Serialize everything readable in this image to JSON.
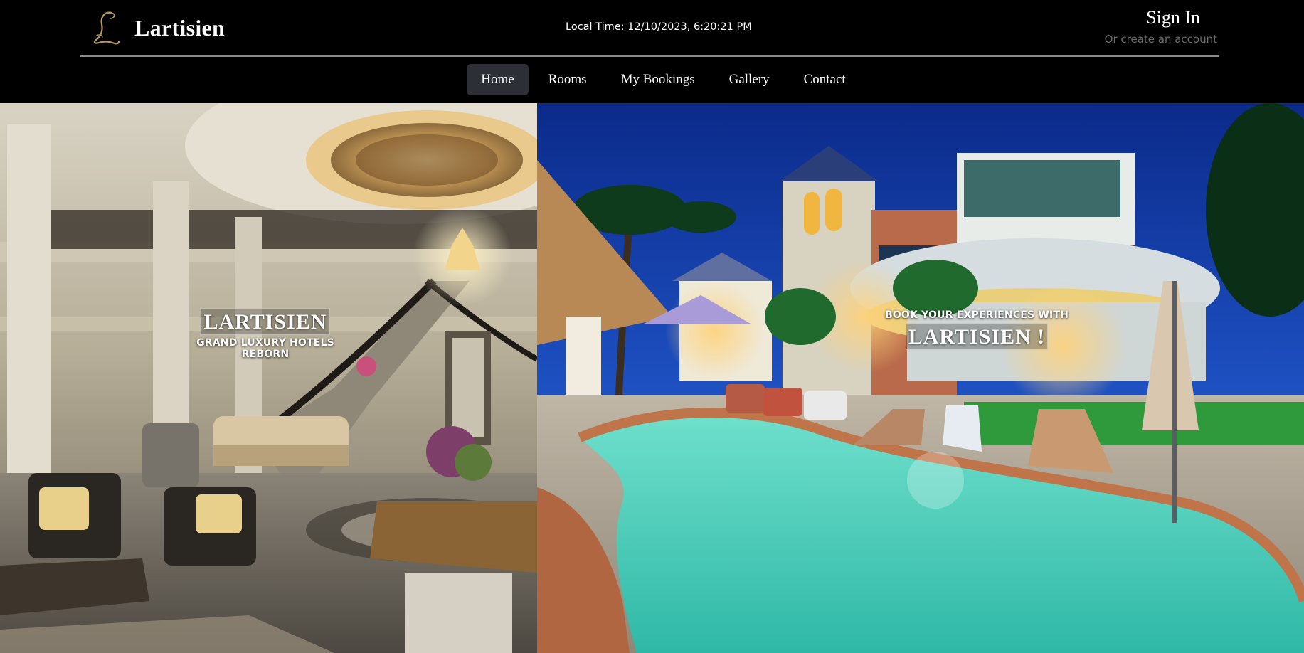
{
  "header": {
    "brand": "Lartisien",
    "logo_icon": "script-l-logo-icon",
    "local_time": "Local Time: 12/10/2023, 6:20:21 PM",
    "sign_in": "Sign In",
    "create_account": "Or create an account"
  },
  "nav": {
    "items": [
      {
        "label": "Home",
        "active": true
      },
      {
        "label": "Rooms",
        "active": false
      },
      {
        "label": "My Bookings",
        "active": false
      },
      {
        "label": "Gallery",
        "active": false
      },
      {
        "label": "Contact",
        "active": false
      }
    ]
  },
  "hero": {
    "left": {
      "title": "LARTISIEN",
      "subtitle": "GRAND LUXURY HOTELS REBORN",
      "image": "hotel-lobby-interior"
    },
    "right": {
      "subtitle": "BOOK YOUR EXPERIENCES WITH",
      "title": "LARTISIEN !",
      "image": "resort-pool-night"
    }
  },
  "colors": {
    "header_bg": "#000000",
    "nav_active_bg": "#2c3036",
    "muted_text": "#6b6b6b",
    "logo_gold": "#b79a62"
  }
}
